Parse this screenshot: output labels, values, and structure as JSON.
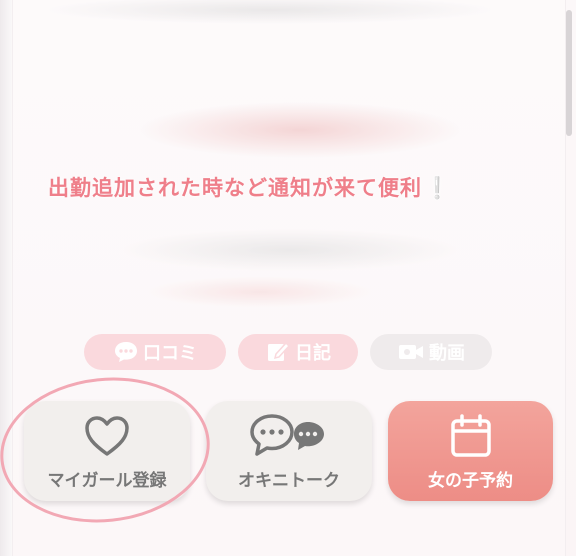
{
  "notice": {
    "text": "出勤追加された時など通知が来て便利",
    "exclaim": "❕"
  },
  "tabs": [
    {
      "label": "口コミ",
      "icon": "chat-bubble-icon"
    },
    {
      "label": "日記",
      "icon": "edit-note-icon"
    },
    {
      "label": "動画",
      "icon": "video-camera-icon"
    }
  ],
  "actions": [
    {
      "label": "マイガール登録",
      "icon": "heart-icon"
    },
    {
      "label": "オキニトーク",
      "icon": "chat-bubbles-icon"
    },
    {
      "label": "女の子予約",
      "icon": "calendar-icon"
    }
  ],
  "colors": {
    "accent_pink": "#ef7f8a",
    "reserve_button": "#ed8d86",
    "inactive_pill": "#efebec",
    "annotation_circle": "#f2a8b4"
  }
}
